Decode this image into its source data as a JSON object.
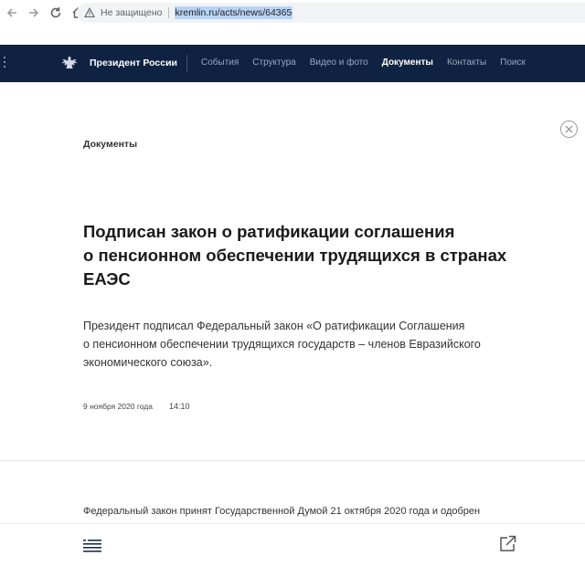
{
  "browser": {
    "security_label": "Не защищено",
    "url": "kremlin.ru/acts/news/64365"
  },
  "header": {
    "site_title": "Президент России",
    "nav": [
      {
        "label": "События",
        "active": false
      },
      {
        "label": "Структура",
        "active": false
      },
      {
        "label": "Видео и фото",
        "active": false
      },
      {
        "label": "Документы",
        "active": true
      },
      {
        "label": "Контакты",
        "active": false
      },
      {
        "label": "Поиск",
        "active": false
      }
    ]
  },
  "article": {
    "section": "Документы",
    "headline_lines": [
      "Подписан закон о ратификации соглашения",
      "о пенсионном обеспечении трудящихся в странах",
      "ЕАЭС"
    ],
    "lead_lines": [
      "Президент подписал Федеральный закон «О ратификации Соглашения",
      "о пенсионном обеспечении трудящихся государств – членов Евразийского",
      "экономического союза»."
    ],
    "date": "9 ноября 2020 года",
    "time": "14:10",
    "body_line": "Федеральный закон принят Государственной Думой 21 октября 2020 года и одобрен"
  },
  "icons": {
    "back": "back-arrow-icon",
    "forward": "forward-arrow-icon",
    "reload": "reload-icon",
    "home": "home-icon",
    "info": "info-icon",
    "menu": "menu-dots-icon",
    "emblem": "emblem-icon",
    "close": "close-icon",
    "toc": "table-of-contents-icon",
    "share": "share-icon"
  },
  "colors": {
    "header_bg": "#0f2241",
    "nav_inactive": "#9aa8bf",
    "nav_active": "#ffffff",
    "url_highlight": "#b9d3f5"
  }
}
